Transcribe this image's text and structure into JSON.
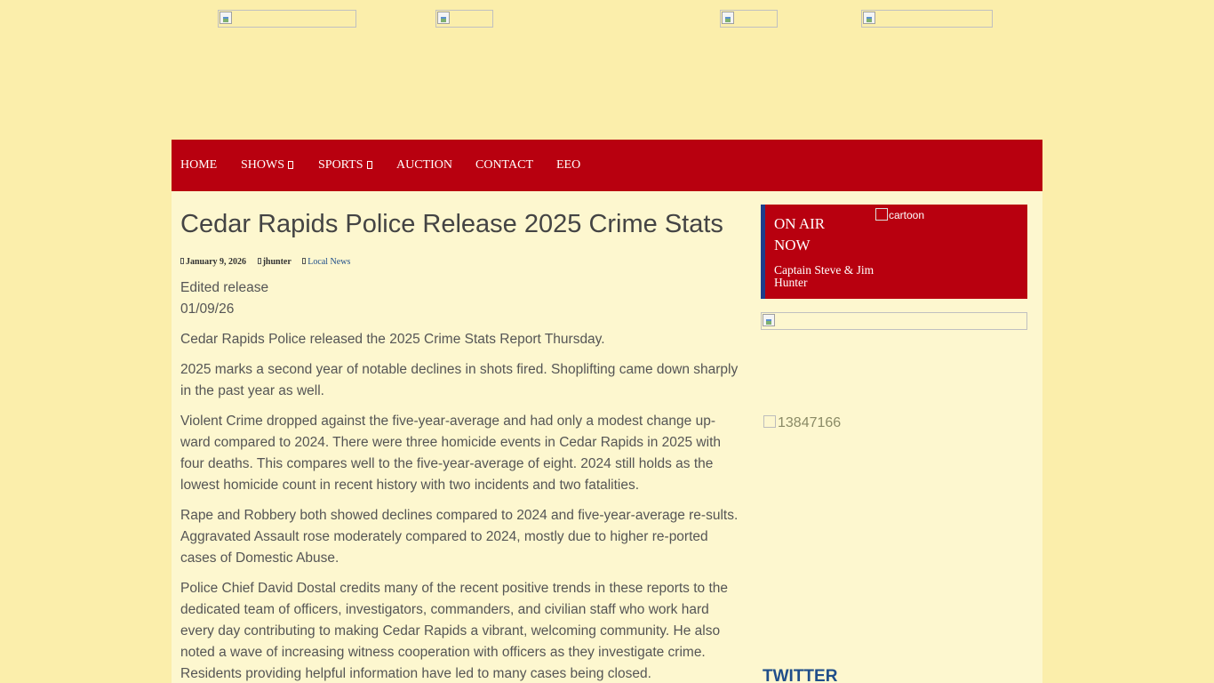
{
  "header": {
    "images": [
      {
        "name": "header-logo-1"
      },
      {
        "name": "header-logo-2"
      },
      {
        "name": "header-logo-3"
      },
      {
        "name": "header-logo-4"
      }
    ]
  },
  "nav": {
    "items": [
      {
        "label": "HOME",
        "has_dropdown": false
      },
      {
        "label": "SHOWS",
        "has_dropdown": true
      },
      {
        "label": "SPORTS",
        "has_dropdown": true
      },
      {
        "label": "AUCTION",
        "has_dropdown": false
      },
      {
        "label": "CONTACT",
        "has_dropdown": false
      },
      {
        "label": "EEO",
        "has_dropdown": false
      }
    ],
    "dropdown_icon": "caret-down-icon"
  },
  "article": {
    "title": "Cedar Rapids Police Release 2025 Crime Stats",
    "meta": {
      "date": "January 9, 2026",
      "author": "jhunter",
      "category": "Local News"
    },
    "edited_label": "Edited release",
    "edited_date": "01/09/26",
    "paragraphs": [
      "Cedar Rapids Police released the 2025 Crime Stats Report Thursday.",
      "2025 marks a second year of notable declines in shots fired. Shoplifting came down sharply in the past year as well.",
      "Violent Crime dropped against the five-year-average and had only a modest change up-ward compared to 2024. There were three homicide events in Cedar Rapids in 2025 with four deaths. This compares well to the five-year-average of eight. 2024 still holds as the lowest homicide count in recent history with two incidents and two fatalities.",
      "Rape and Robbery both showed declines compared to 2024 and five-year-average re-sults. Aggravated Assault rose moderately compared to 2024, mostly due to higher re-ported cases of Domestic Abuse.",
      "Police Chief David Dostal credits many of the recent positive trends in these reports to the dedicated team of officers, investigators, commanders, and civilian staff who work hard every day contributing to making Cedar Rapids a vibrant, welcoming community. He also noted a wave of increasing witness cooperation with officers as they investigate crime. Residents providing helpful information have led to many cases being closed."
    ]
  },
  "sidebar": {
    "on_air": {
      "title": "ON AIR NOW",
      "host": "Captain Steve & Jim Hunter",
      "image_alt": "cartoon"
    },
    "ad_image_alt": "13847166",
    "twitter_heading": "TWITTER"
  },
  "colors": {
    "page_bg": "#fbeeab",
    "nav_bg": "#b8000f",
    "on_air_border": "#1f3d8a",
    "link": "#1f4e8a"
  }
}
